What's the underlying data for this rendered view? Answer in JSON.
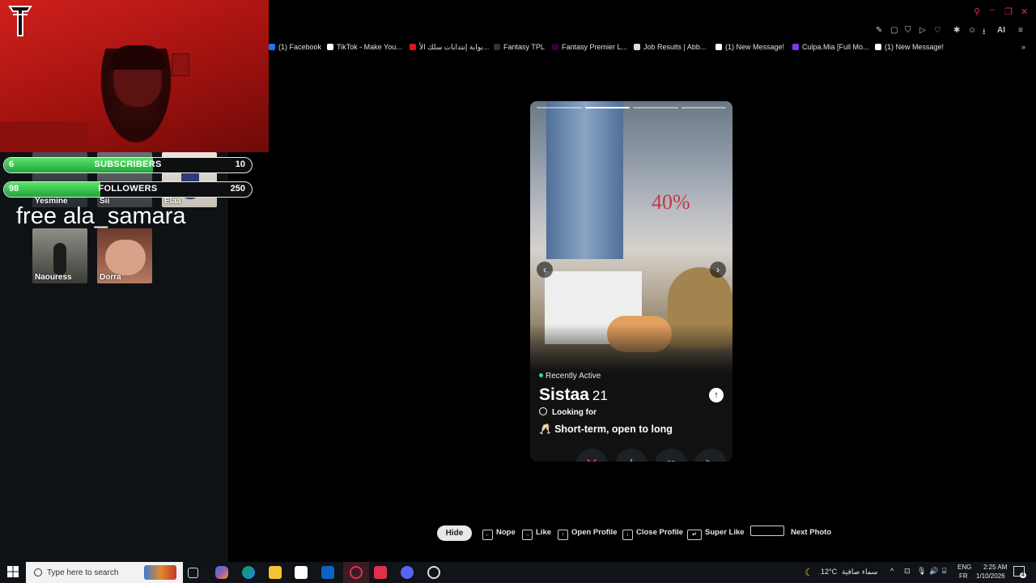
{
  "overlay": {
    "subscribers": {
      "level": "6",
      "label": "SUBSCRIBERS",
      "goal": "10",
      "progress": 0.6
    },
    "followers": {
      "level": "98",
      "label": "FOLLOWERS",
      "goal": "250",
      "progress": 0.39
    },
    "thumbnails": [
      "Yesmine",
      "Sii",
      "Elaa",
      "Naouress",
      "Dorra"
    ],
    "banner_text": "free ala_samara"
  },
  "browser": {
    "bookmarks": [
      {
        "label": "(1) Facebook",
        "icon": "facebook-icon",
        "color": "#1877f2"
      },
      {
        "label": "TikTok - Make You...",
        "icon": "tiktok-icon",
        "color": "#ffffff"
      },
      {
        "label": "بوابة إنتدابات سلك الأ...",
        "icon": "tn-portal-icon",
        "color": "#e0121b"
      },
      {
        "label": "Fantasy TPL",
        "icon": "fantasy-icon",
        "color": "#333333"
      },
      {
        "label": "Fantasy Premier L...",
        "icon": "premier-league-icon",
        "color": "#37003c"
      },
      {
        "label": "Job Results | Abb...",
        "icon": "search-icon",
        "color": "#dddddd"
      },
      {
        "label": "(1) New Message!",
        "icon": "message-icon",
        "color": "#ffffff"
      },
      {
        "label": "Culpa.Mia [Full Mo...",
        "icon": "video-icon",
        "color": "#7c3aed"
      },
      {
        "label": "(1) New Message!",
        "icon": "message-icon",
        "color": "#ffffff"
      }
    ],
    "ai_label": "AI"
  },
  "card": {
    "status": "Recently Active",
    "name": "Sistaa",
    "age": "21",
    "looking_for_label": "Looking for",
    "intent_emoji": "🥂",
    "intent": "Short-term, open to long",
    "photo_count": 4,
    "current_photo": 1,
    "actions": [
      {
        "name": "nope",
        "glyph": "✕",
        "color": "#fd267a"
      },
      {
        "name": "super-like",
        "glyph": "★",
        "color": "#3ca4ff"
      },
      {
        "name": "like",
        "glyph": "♥",
        "color": "#4ed86a"
      },
      {
        "name": "boost",
        "glyph": "➤",
        "color": "#3ca4ff"
      }
    ]
  },
  "shortcuts": {
    "hide": "Hide",
    "items": [
      "Nope",
      "Like",
      "Open Profile",
      "Close Profile",
      "Super Like",
      "Next Photo"
    ]
  },
  "taskbar": {
    "search_placeholder": "Type here to search",
    "weather": "12°C",
    "weather_desc": "سماء صافية",
    "lang_top": "ENG",
    "lang_bottom": "FR",
    "time": "2:25 AM",
    "date": "1/10/2026",
    "notifications": "4"
  }
}
